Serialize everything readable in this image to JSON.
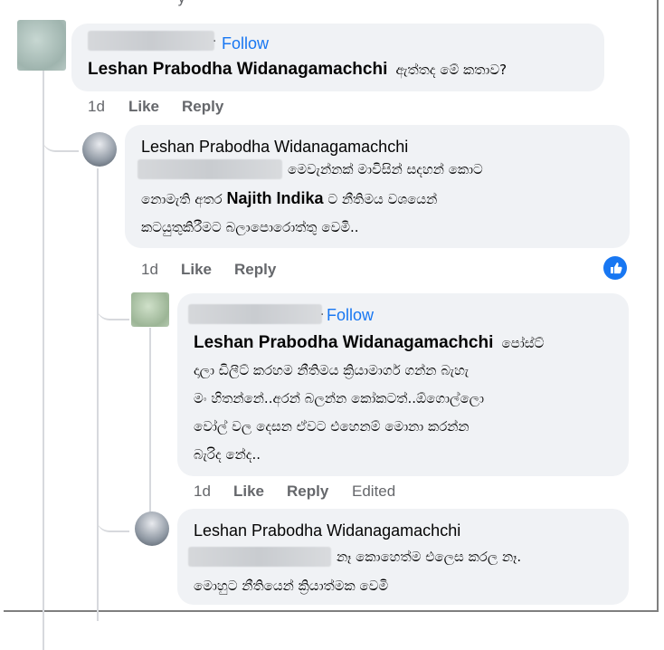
{
  "top_fragment": "y",
  "comments": [
    {
      "author_blurred": true,
      "follow_label": "Follow",
      "mention_name": "Leshan Prabodha Widanagamachchi",
      "body": "ඇත්තද මේ කතාව?",
      "time": "1d",
      "like_label": "Like",
      "reply_label": "Reply"
    },
    {
      "author": "Leshan Prabodha Widanagamachchi",
      "body_line1": "මෙවැන්නක් මාවිසින් සදහන් කොට",
      "body_line2_pre": "නොමැති අතර",
      "body_line2_mention": "Najith Indika",
      "body_line2_post": "ට නීතිමය වශයෙන්",
      "body_line3": "කටයුතුකිරීමට බලාපොරොත්තු වෙමි..",
      "time": "1d",
      "like_label": "Like",
      "reply_label": "Reply",
      "reaction_icon": "like-reaction-icon",
      "accent": "#1877f2"
    },
    {
      "author_blurred": true,
      "follow_label": "Follow",
      "mention_name": "Leshan Prabodha Widanagamachchi",
      "body_line1_tail": "පෝස්ට්",
      "body_line2": "දාලා ඩිලීට් කරහම නීතිමය ක්‍රියාමාර්ග ගන්න බැහැ",
      "body_line3": "මං හිතන්නේ..අරන් බලන්න කෝකටත්..ඕගොල්ලො",
      "body_line4": "වෝල් වල දෙසන ඒවට එහෙනම් මොනා කරන්න",
      "body_line5": "බැරිද නේද..",
      "time": "1d",
      "like_label": "Like",
      "reply_label": "Reply",
      "edited_label": "Edited"
    },
    {
      "author": "Leshan Prabodha Widanagamachchi",
      "body_line1": "නෑ කොහෙත්ම එලෙස කරල නෑ.",
      "body_line2": "මොහුට නීතියෙන් ක්‍රියාත්මක වෙමි"
    }
  ]
}
